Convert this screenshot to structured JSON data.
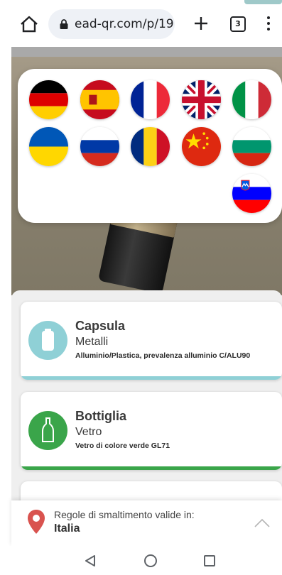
{
  "browser": {
    "url": "ead-qr.com/p/19",
    "tab_count": "3",
    "icons": [
      "home-icon",
      "lock-icon",
      "plus-icon",
      "tabs-icon",
      "more-vert-icon"
    ]
  },
  "languages": [
    {
      "code": "de",
      "name": "German flag"
    },
    {
      "code": "es",
      "name": "Spanish flag"
    },
    {
      "code": "fr",
      "name": "French flag"
    },
    {
      "code": "gb",
      "name": "British flag"
    },
    {
      "code": "it",
      "name": "Italian flag"
    },
    {
      "code": "ua",
      "name": "Ukrainian flag"
    },
    {
      "code": "ru",
      "name": "Russian flag"
    },
    {
      "code": "ro",
      "name": "Romanian flag"
    },
    {
      "code": "cn",
      "name": "Chinese flag"
    },
    {
      "code": "bg",
      "name": "Bulgarian flag"
    },
    {
      "code": "si",
      "name": "Slovenian flag"
    }
  ],
  "cards": [
    {
      "title": "Capsula",
      "material": "Metalli",
      "detail": "Alluminio/Plastica, prevalenza alluminio C/ALU90",
      "color": "#8fd0d6",
      "icon": "can-icon"
    },
    {
      "title": "Bottiglia",
      "material": "Vetro",
      "detail": "Vetro di colore verde GL71",
      "color": "#3aa54a",
      "icon": "bottle-icon"
    }
  ],
  "rules": {
    "label": "Regole di smaltimento valide in:",
    "country": "Italia",
    "pin_color": "#d9534f"
  }
}
